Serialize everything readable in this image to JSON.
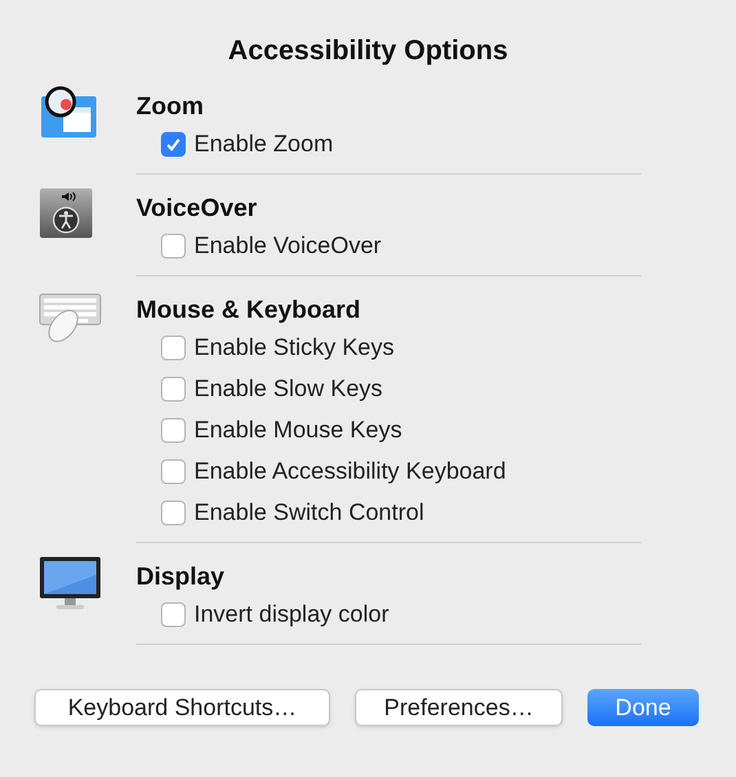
{
  "window": {
    "title": "Accessibility Options"
  },
  "sections": [
    {
      "kind": "zoom",
      "heading": "Zoom",
      "options": [
        {
          "label": "Enable Zoom",
          "checked": true
        }
      ]
    },
    {
      "kind": "voiceover",
      "heading": "VoiceOver",
      "options": [
        {
          "label": "Enable VoiceOver",
          "checked": false
        }
      ]
    },
    {
      "kind": "mouse_keyboard",
      "heading": "Mouse & Keyboard",
      "options": [
        {
          "label": "Enable Sticky Keys",
          "checked": false
        },
        {
          "label": "Enable Slow Keys",
          "checked": false
        },
        {
          "label": "Enable Mouse Keys",
          "checked": false
        },
        {
          "label": "Enable Accessibility Keyboard",
          "checked": false
        },
        {
          "label": "Enable Switch Control",
          "checked": false
        }
      ]
    },
    {
      "kind": "display",
      "heading": "Display",
      "options": [
        {
          "label": "Invert display color",
          "checked": false
        }
      ]
    }
  ],
  "buttons": [
    {
      "label": "Keyboard Shortcuts…",
      "kind": "default"
    },
    {
      "label": "Preferences…",
      "kind": "default"
    },
    {
      "label": "Done",
      "kind": "primary"
    }
  ]
}
